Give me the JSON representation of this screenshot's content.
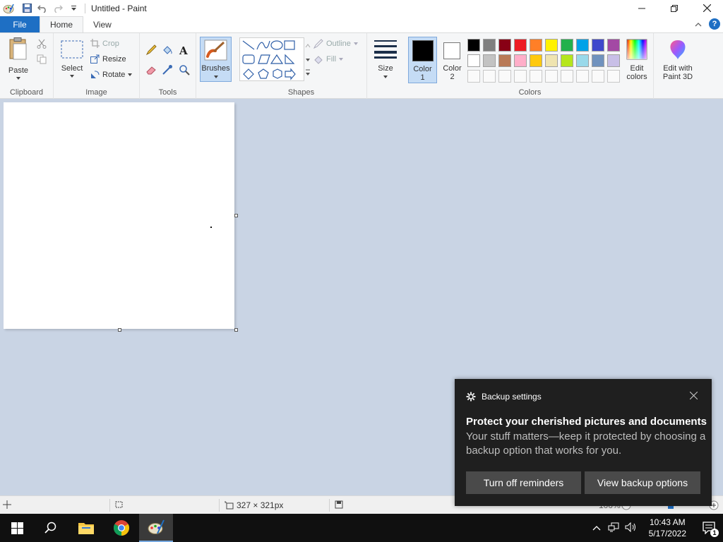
{
  "titlebar": {
    "title": "Untitled - Paint"
  },
  "tabs": {
    "file": "File",
    "home": "Home",
    "view": "View"
  },
  "ribbon": {
    "clipboard": {
      "label": "Clipboard",
      "paste": "Paste"
    },
    "image": {
      "label": "Image",
      "select": "Select",
      "crop": "Crop",
      "resize": "Resize",
      "rotate": "Rotate"
    },
    "tools": {
      "label": "Tools"
    },
    "brushes": {
      "label": "Brushes"
    },
    "shapes": {
      "label": "Shapes",
      "outline": "Outline",
      "fill": "Fill"
    },
    "size": {
      "label": "Size"
    },
    "color1": {
      "line1": "Color",
      "line2": "1"
    },
    "color2": {
      "line1": "Color",
      "line2": "2"
    },
    "colors": {
      "label": "Colors"
    },
    "edit_colors": {
      "line1": "Edit",
      "line2": "colors"
    },
    "paint3d": {
      "line1": "Edit with",
      "line2": "Paint 3D"
    }
  },
  "palette": {
    "row1": [
      "#000000",
      "#7f7f7f",
      "#880015",
      "#ed1c24",
      "#ff7f27",
      "#fff200",
      "#22b14c",
      "#00a2e8",
      "#3f48cc",
      "#a349a4"
    ],
    "row2": [
      "#ffffff",
      "#c3c3c3",
      "#b97a57",
      "#ffaec9",
      "#ffc90e",
      "#efe4b0",
      "#b5e61d",
      "#99d9ea",
      "#7092be",
      "#c8bfe7"
    ]
  },
  "status": {
    "dimensions": "327 × 321px",
    "zoom": "100%"
  },
  "toast": {
    "app": "Backup settings",
    "title": "Protect your cherished pictures and documents",
    "body": "Your stuff matters—keep it protected by choosing a backup option that works for you.",
    "button1": "Turn off reminders",
    "button2": "View backup options"
  },
  "taskbar": {
    "time": "10:43 AM",
    "date": "5/17/2022",
    "notification_count": "1"
  }
}
